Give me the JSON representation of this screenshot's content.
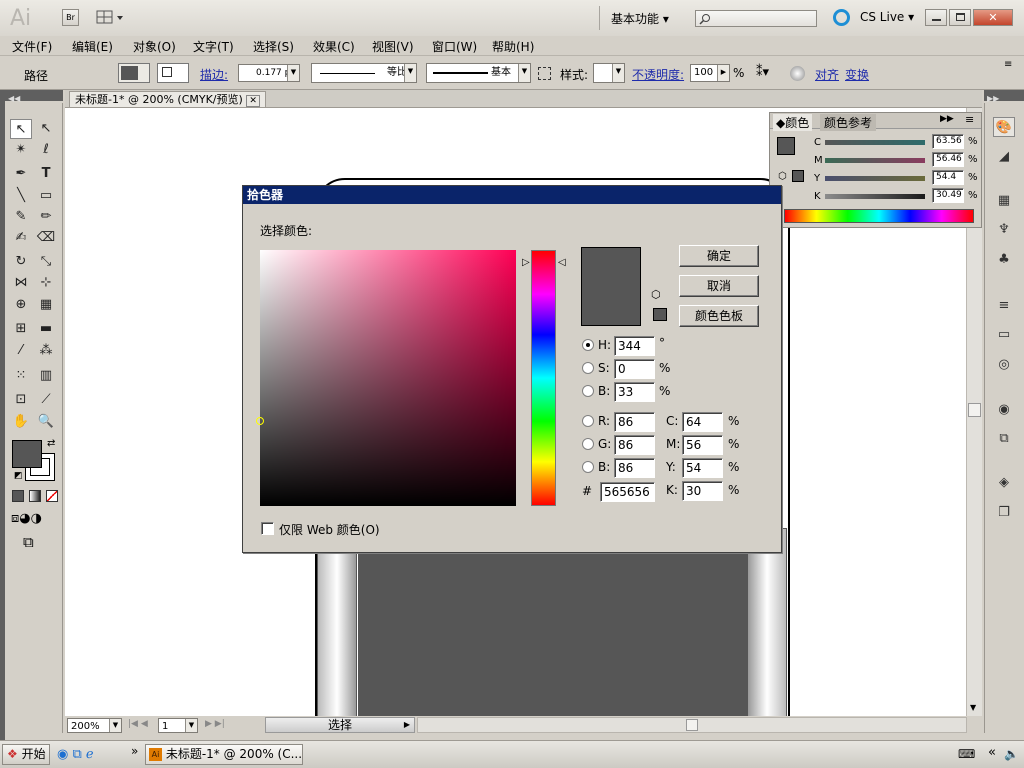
{
  "app": {
    "logo": "Ai",
    "bridge": "Br",
    "workspace": "基本功能",
    "cslive": "CS Live"
  },
  "menu": [
    "文件(F)",
    "编辑(E)",
    "对象(O)",
    "文字(T)",
    "选择(S)",
    "效果(C)",
    "视图(V)",
    "窗口(W)",
    "帮助(H)"
  ],
  "controlbar": {
    "mode": "路径",
    "stroke_label": "描边:",
    "stroke_value": "0.177 p",
    "profile1": "等比",
    "profile2": "基本",
    "style_label": "样式:",
    "opacity_label": "不透明度:",
    "opacity_value": "100",
    "opacity_unit": "%",
    "align": "对齐",
    "transform": "变换"
  },
  "document": {
    "tab_title": "未标题-1* @ 200% (CMYK/预览)",
    "zoom": "200%",
    "page": "1",
    "status": "选择"
  },
  "colorpanel": {
    "tab_color": "颜色",
    "tab_guide": "颜色参考",
    "channels": [
      {
        "label": "C",
        "value": "63.56",
        "unit": "%"
      },
      {
        "label": "M",
        "value": "56.46",
        "unit": "%"
      },
      {
        "label": "Y",
        "value": "54.4",
        "unit": "%"
      },
      {
        "label": "K",
        "value": "30.49",
        "unit": "%"
      }
    ]
  },
  "dialog": {
    "title": "拾色器",
    "prompt": "选择颜色:",
    "ok": "确定",
    "cancel": "取消",
    "swatches": "颜色色板",
    "hsb": [
      {
        "label": "H:",
        "value": "344",
        "unit": "°"
      },
      {
        "label": "S:",
        "value": "0",
        "unit": "%"
      },
      {
        "label": "B:",
        "value": "33",
        "unit": "%"
      }
    ],
    "rgb": [
      {
        "label": "R:",
        "value": "86"
      },
      {
        "label": "G:",
        "value": "86"
      },
      {
        "label": "B:",
        "value": "86"
      }
    ],
    "cmyk": [
      {
        "label": "C:",
        "value": "64",
        "unit": "%"
      },
      {
        "label": "M:",
        "value": "56",
        "unit": "%"
      },
      {
        "label": "Y:",
        "value": "54",
        "unit": "%"
      },
      {
        "label": "K:",
        "value": "30",
        "unit": "%"
      }
    ],
    "hex_label": "#",
    "hex": "565656",
    "web_only": "仅限 Web 颜色(O)",
    "current_color": "#565656"
  },
  "taskbar": {
    "start": "开始",
    "task": "未标题-1* @ 200% (C..."
  },
  "colors": {
    "selected": "#565656",
    "dialog_title": "#0a246a"
  }
}
